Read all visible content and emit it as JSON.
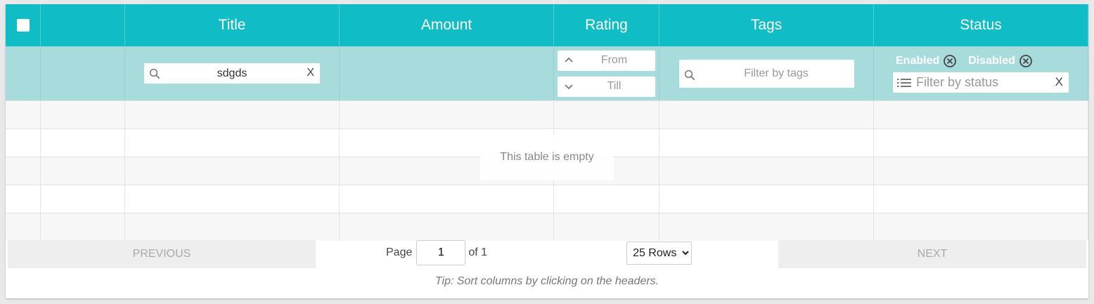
{
  "columns": {
    "title": "Title",
    "amount": "Amount",
    "rating": "Rating",
    "tags": "Tags",
    "status": "Status"
  },
  "filters": {
    "title_value": "sdgds",
    "title_clear": "X",
    "rating_from_placeholder": "From",
    "rating_till_placeholder": "Till",
    "tags_placeholder": "Filter by tags",
    "status_chips": [
      "Enabled",
      "Disabled"
    ],
    "status_placeholder": "Filter by status",
    "status_clear": "X"
  },
  "empty_message": "This table is empty",
  "pagination": {
    "previous": "PREVIOUS",
    "next": "NEXT",
    "page_label": "Page",
    "page_value": "1",
    "of_label": "of 1",
    "rows_selected": "25 Rows"
  },
  "tip": "Tip: Sort columns by clicking on the headers.",
  "colors": {
    "header": "#10bdc6",
    "filter_row": "#a8dbdc"
  }
}
